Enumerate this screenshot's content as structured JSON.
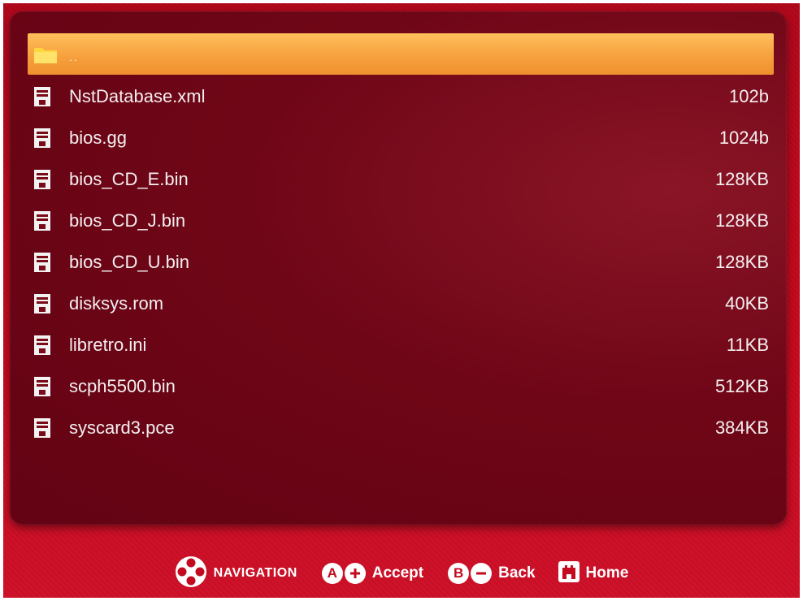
{
  "file_list": {
    "parent": {
      "label": "..",
      "icon": "folder-icon"
    },
    "files": [
      {
        "name": "NstDatabase.xml",
        "size": "102b",
        "icon": "file-icon"
      },
      {
        "name": "bios.gg",
        "size": "1024b",
        "icon": "file-icon"
      },
      {
        "name": "bios_CD_E.bin",
        "size": "128KB",
        "icon": "file-icon"
      },
      {
        "name": "bios_CD_J.bin",
        "size": "128KB",
        "icon": "file-icon"
      },
      {
        "name": "bios_CD_U.bin",
        "size": "128KB",
        "icon": "file-icon"
      },
      {
        "name": "disksys.rom",
        "size": "40KB",
        "icon": "file-icon"
      },
      {
        "name": "libretro.ini",
        "size": "11KB",
        "icon": "file-icon"
      },
      {
        "name": "scph5500.bin",
        "size": "512KB",
        "icon": "file-icon"
      },
      {
        "name": "syscard3.pce",
        "size": "384KB",
        "icon": "file-icon"
      }
    ]
  },
  "footer": {
    "navigation_label": "NAVIGATION",
    "accept_button": "A",
    "accept_label": "Accept",
    "back_button": "B",
    "back_label": "Back",
    "home_label": "Home"
  },
  "colors": {
    "selection": "#f6a13e",
    "background": "#c90b1f",
    "panel": "#6f0617",
    "text": "#f4eef0"
  }
}
